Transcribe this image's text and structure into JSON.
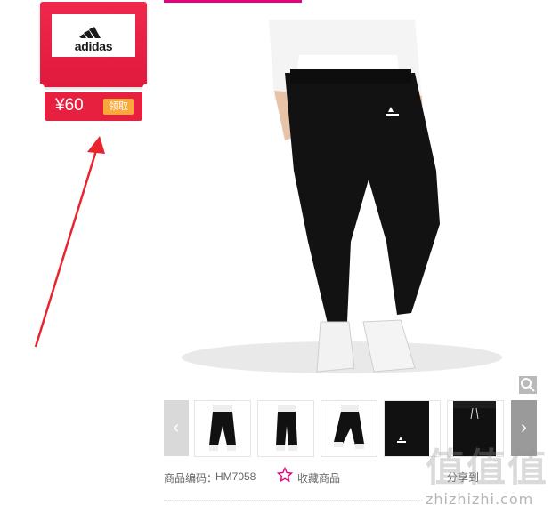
{
  "coupon": {
    "brand": "adidas",
    "price": "¥60",
    "claim_label": "领取"
  },
  "product": {
    "sku_label": "商品编码：",
    "sku_value": "HM7058",
    "favorite_label": "收藏商品",
    "share_label": "分享到"
  },
  "thumbnails": {
    "prev_icon": "chevron-left-icon",
    "next_icon": "chevron-right-icon",
    "count": 5
  },
  "watermark": {
    "big": "值值值",
    "small": "zhizhizhi.com"
  },
  "colors": {
    "coupon_red": "#e8203f",
    "claim_orange": "#f9a83a",
    "accent_pink": "#e4007f",
    "arrow_red": "#e8252e"
  }
}
